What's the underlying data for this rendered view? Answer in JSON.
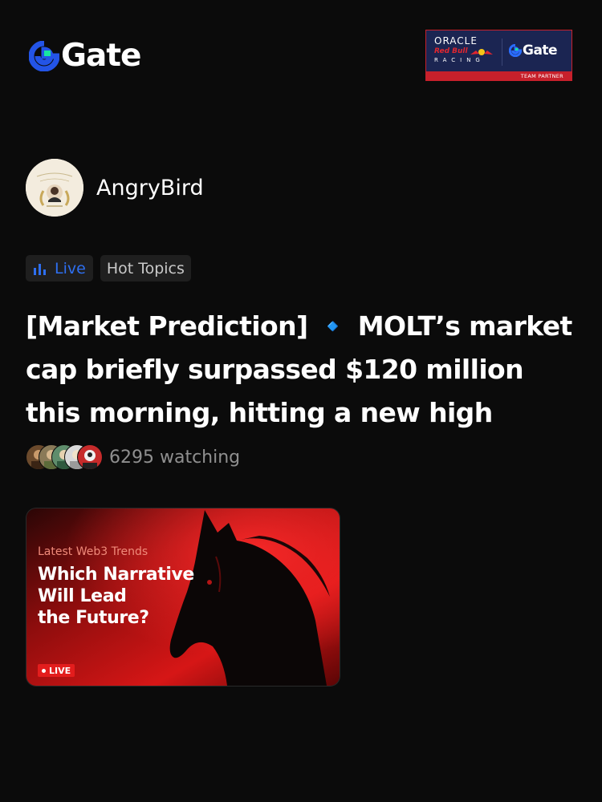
{
  "header": {
    "logo_text": "Gate",
    "logo_icon": "gate-g-icon",
    "partner": {
      "oracle": "ORACLE",
      "redbull": "Red Bull",
      "racing": "RACING",
      "gate_text": "Gate",
      "team_partner": "TEAM PARTNER"
    }
  },
  "author": {
    "name": "AngryBird",
    "avatar_icon": "profile-avatar"
  },
  "tags": {
    "live_label": "Live",
    "live_icon": "bar-chart-icon",
    "topic_label": "Hot Topics"
  },
  "post": {
    "headline": "[Market Prediction] 🔹 MOLT’s market cap briefly surpassed $120 million this morning, hitting a new high"
  },
  "watchers": {
    "count_text": "6295 watching"
  },
  "thumbnail": {
    "kicker": "Latest Web3 Trends",
    "title_lines": [
      "Which Narrative",
      "Will Lead",
      "the Future?"
    ],
    "live_badge": "LIVE"
  },
  "colors": {
    "background": "#0b0b0b",
    "accent_blue": "#2e6ff0",
    "gate_green": "#17e6a1",
    "live_red": "#e31d1d"
  }
}
